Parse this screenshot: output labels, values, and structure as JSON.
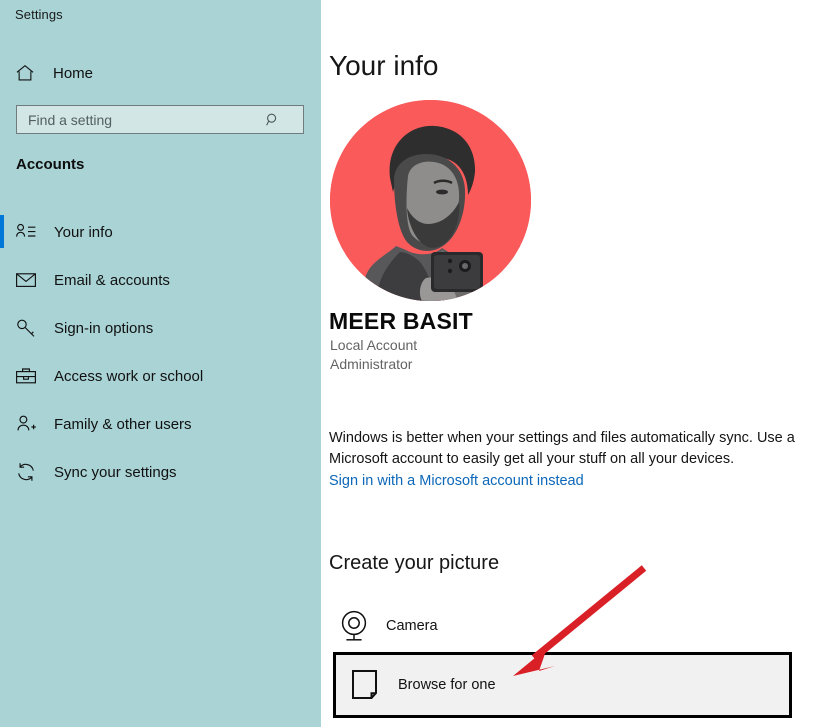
{
  "window": {
    "app_title": "Settings"
  },
  "sidebar": {
    "home_label": "Home",
    "home_icon": "home-icon",
    "search": {
      "placeholder": "Find a setting",
      "value": "",
      "icon": "search-icon"
    },
    "section_header": "Accounts",
    "items": [
      {
        "label": "Your info",
        "icon": "person-info-icon",
        "selected": true
      },
      {
        "label": "Email & accounts",
        "icon": "envelope-icon",
        "selected": false
      },
      {
        "label": "Sign-in options",
        "icon": "key-icon",
        "selected": false
      },
      {
        "label": "Access work or school",
        "icon": "briefcase-icon",
        "selected": false
      },
      {
        "label": "Family & other users",
        "icon": "person-plus-icon",
        "selected": false
      },
      {
        "label": "Sync your settings",
        "icon": "sync-icon",
        "selected": false
      }
    ]
  },
  "main": {
    "page_title": "Your info",
    "avatar": {
      "alt": "user-profile-photo",
      "background_color": "#fb5a5a"
    },
    "user_name": "MEER BASIT",
    "account_type": "Local Account",
    "account_role": "Administrator",
    "sync_description": "Windows is better when your settings and files automatically sync. Use a Microsoft account to easily get all your stuff on all your devices.",
    "microsoft_link": "Sign in with a Microsoft account instead",
    "create_picture_header": "Create your picture",
    "picture_options": [
      {
        "label": "Camera",
        "icon": "webcam-icon"
      },
      {
        "label": "Browse for one",
        "icon": "picture-file-icon"
      }
    ]
  },
  "annotation": {
    "arrow_color": "#d92027",
    "highlight_border_color": "#000000",
    "highlight_fill_color": "#f1f1f1"
  },
  "colors": {
    "sidebar_background": "#a9d3d5",
    "selection_accent": "#0078d7",
    "link": "#0c67b8",
    "avatar_red": "#fb5a5a"
  }
}
